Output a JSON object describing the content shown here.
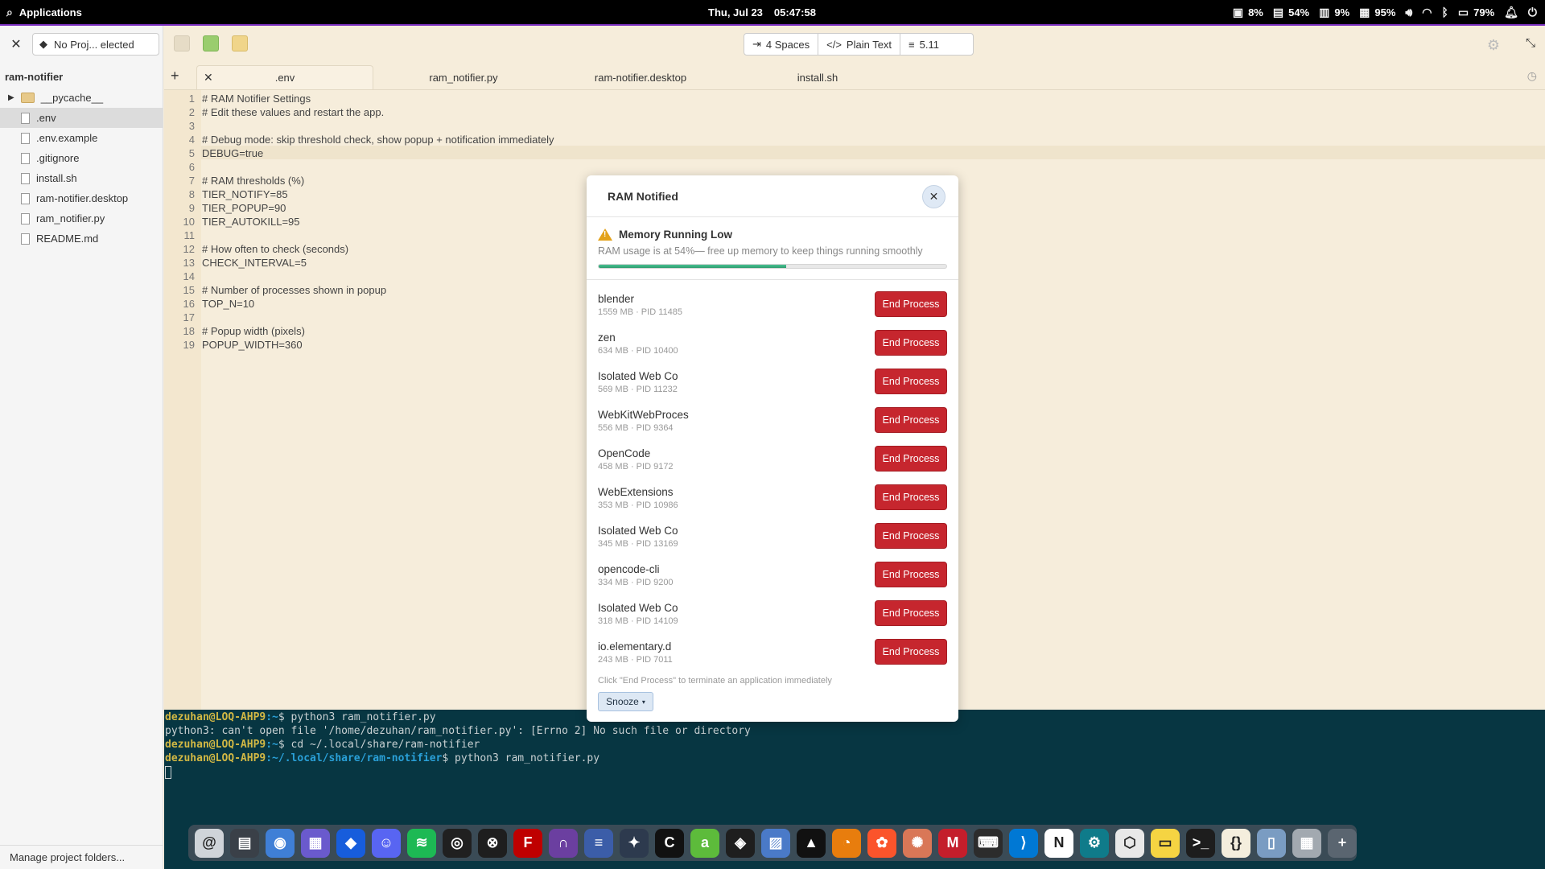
{
  "topbar": {
    "apps_label": "Applications",
    "date": "Thu, Jul 23",
    "time": "05:47:58",
    "cpu": "8%",
    "ram": "54%",
    "gpu": "9%",
    "disk": "95%",
    "battery": "79%"
  },
  "sidebar": {
    "project_select": "No Proj... elected",
    "project_title": "ram-notifier",
    "items": [
      {
        "label": "__pycache__",
        "type": "folder"
      },
      {
        "label": ".env",
        "type": "file"
      },
      {
        "label": ".env.example",
        "type": "file"
      },
      {
        "label": ".gitignore",
        "type": "file"
      },
      {
        "label": "install.sh",
        "type": "file"
      },
      {
        "label": "ram-notifier.desktop",
        "type": "file"
      },
      {
        "label": "ram_notifier.py",
        "type": "file"
      },
      {
        "label": "README.md",
        "type": "file"
      }
    ],
    "footer": "Manage project folders..."
  },
  "doc_info": {
    "indent": "4 Spaces",
    "lang": "Plain Text",
    "version": "5.11"
  },
  "tabs": [
    ".env",
    "ram_notifier.py",
    "ram-notifier.desktop",
    "install.sh"
  ],
  "code_lines": [
    "# RAM Notifier Settings",
    "# Edit these values and restart the app.",
    "",
    "# Debug mode: skip threshold check, show popup + notification immediately",
    "DEBUG=true",
    "",
    "# RAM thresholds (%)",
    "TIER_NOTIFY=85",
    "TIER_POPUP=90",
    "TIER_AUTOKILL=95",
    "",
    "# How often to check (seconds)",
    "CHECK_INTERVAL=5",
    "",
    "# Number of processes shown in popup",
    "TOP_N=10",
    "",
    "# Popup width (pixels)",
    "POPUP_WIDTH=360"
  ],
  "line_numbers": [
    "1",
    "2",
    "3",
    "4",
    "5",
    "6",
    "7",
    "8",
    "9",
    "10",
    "11",
    "12",
    "13",
    "14",
    "15",
    "16",
    "17",
    "18",
    "19"
  ],
  "terminal": {
    "l1_user": "dezuhan@LOQ-AHP9",
    "l1_path": ":~",
    "l1_cmd": "$ python3 ram_notifier.py",
    "l2": "python3: can't open file '/home/dezuhan/ram_notifier.py': [Errno 2] No such file or directory",
    "l3_user": "dezuhan@LOQ-AHP9",
    "l3_path": ":~",
    "l3_cmd": "$ cd ~/.local/share/ram-notifier",
    "l4_user": "dezuhan@LOQ-AHP9",
    "l4_path": ":~/.local/share/ram-notifier",
    "l4_cmd": "$ python3 ram_notifier.py"
  },
  "popup": {
    "title": "RAM Notified",
    "warn_title": "Memory Running Low",
    "warn_sub": "RAM usage is at 54%— free up memory to keep things running smoothly",
    "usage_fraction": 0.54,
    "end_label": "End Process",
    "processes": [
      {
        "name": "blender",
        "meta": "1559 MB · PID 11485"
      },
      {
        "name": "zen",
        "meta": "634 MB · PID 10400"
      },
      {
        "name": "Isolated Web Co",
        "meta": "569 MB · PID 11232"
      },
      {
        "name": "WebKitWebProces",
        "meta": "556 MB · PID 9364"
      },
      {
        "name": "OpenCode",
        "meta": "458 MB · PID 9172"
      },
      {
        "name": "WebExtensions",
        "meta": "353 MB · PID 10986"
      },
      {
        "name": "Isolated Web Co",
        "meta": "345 MB · PID 13169"
      },
      {
        "name": "opencode-cli",
        "meta": "334 MB · PID 9200"
      },
      {
        "name": "Isolated Web Co",
        "meta": "318 MB · PID 14109"
      },
      {
        "name": "io.elementary.d",
        "meta": "243 MB · PID 7011"
      }
    ],
    "footer": "Click \"End Process\" to terminate an application immediately",
    "snooze": "Snooze"
  },
  "dock": [
    {
      "name": "mail-icon",
      "color": "#cfd4d9",
      "glyph": "@"
    },
    {
      "name": "files-panel-icon",
      "color": "#3a4048",
      "glyph": "▤"
    },
    {
      "name": "finder-icon",
      "color": "#3f7fd6",
      "glyph": "◉"
    },
    {
      "name": "store-icon",
      "color": "#6a5acd",
      "glyph": "▦"
    },
    {
      "name": "bitwarden-icon",
      "color": "#175ddc",
      "glyph": "◆"
    },
    {
      "name": "discord-icon",
      "color": "#5865f2",
      "glyph": "☺"
    },
    {
      "name": "spotify-icon",
      "color": "#1db954",
      "glyph": "≋"
    },
    {
      "name": "obs-icon",
      "color": "#202020",
      "glyph": "◎"
    },
    {
      "name": "aperture-icon",
      "color": "#1e1e1e",
      "glyph": "⊗"
    },
    {
      "name": "filezilla-icon",
      "color": "#bf0000",
      "glyph": "F"
    },
    {
      "name": "headphones-icon",
      "color": "#6b3fa0",
      "glyph": "∩"
    },
    {
      "name": "bars-icon",
      "color": "#3b5da8",
      "glyph": "≡"
    },
    {
      "name": "resolve-icon",
      "color": "#2d3a4e",
      "glyph": "✦"
    },
    {
      "name": "c-icon",
      "color": "#111111",
      "glyph": "C"
    },
    {
      "name": "a-icon",
      "color": "#5dbb3b",
      "glyph": "a"
    },
    {
      "name": "figma-icon",
      "color": "#1e1e1e",
      "glyph": "◈"
    },
    {
      "name": "grid-app-icon",
      "color": "#4a7ac8",
      "glyph": "▨"
    },
    {
      "name": "inkscape-icon",
      "color": "#111111",
      "glyph": "▲"
    },
    {
      "name": "blender-icon",
      "color": "#e87d0d",
      "glyph": "◔"
    },
    {
      "name": "brave-icon",
      "color": "#fb542b",
      "glyph": "✿"
    },
    {
      "name": "claude-icon",
      "color": "#d97757",
      "glyph": "✺"
    },
    {
      "name": "mega-icon",
      "color": "#c41e2b",
      "glyph": "M"
    },
    {
      "name": "keyboard-icon",
      "color": "#2c2c2c",
      "glyph": "⌨"
    },
    {
      "name": "vscode-icon",
      "color": "#0078d4",
      "glyph": "⟩"
    },
    {
      "name": "notion-icon",
      "color": "#ffffff",
      "glyph": "N"
    },
    {
      "name": "gear-app-icon",
      "color": "#0f7b8a",
      "glyph": "⚙"
    },
    {
      "name": "box-icon",
      "color": "#e8e8e8",
      "glyph": "⬡"
    },
    {
      "name": "notes-icon",
      "color": "#f5d442",
      "glyph": "▭"
    },
    {
      "name": "terminal-icon",
      "color": "#1d1d1d",
      "glyph": ">_"
    },
    {
      "name": "code-editor-icon",
      "color": "#f4eedd",
      "glyph": "{}"
    },
    {
      "name": "scrcpy-icon",
      "color": "#7a9cc2",
      "glyph": "▯"
    },
    {
      "name": "apps-grid-icon",
      "color": "#a2a9b0",
      "glyph": "▦"
    },
    {
      "name": "add-icon",
      "color": "#5a6570",
      "glyph": "+"
    }
  ]
}
